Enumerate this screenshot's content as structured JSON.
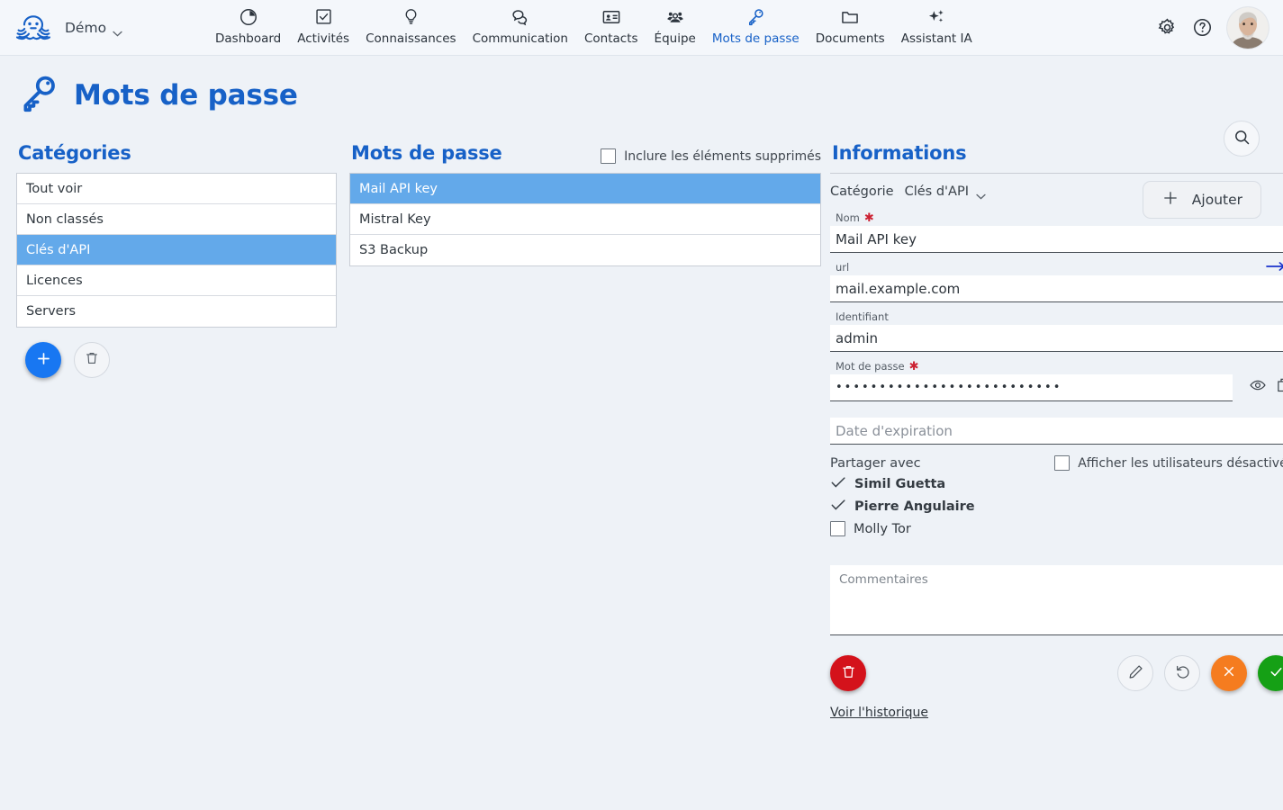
{
  "topbar": {
    "logo_icon": "octopus-logo",
    "org_name": "Démo",
    "org_caret_icon": "chevron-down-icon",
    "nav": [
      {
        "label": "Dashboard",
        "icon": "pie-chart-icon",
        "active": false
      },
      {
        "label": "Activités",
        "icon": "checkbox-icon",
        "active": false
      },
      {
        "label": "Connaissances",
        "icon": "lightbulb-icon",
        "active": false
      },
      {
        "label": "Communication",
        "icon": "chat-bubbles-icon",
        "active": false
      },
      {
        "label": "Contacts",
        "icon": "contact-card-icon",
        "active": false
      },
      {
        "label": "Équipe",
        "icon": "people-icon",
        "active": false
      },
      {
        "label": "Mots de passe",
        "icon": "key-icon",
        "active": true
      },
      {
        "label": "Documents",
        "icon": "folder-icon",
        "active": false
      },
      {
        "label": "Assistant IA",
        "icon": "sparkles-icon",
        "active": false
      }
    ],
    "settings_icon": "gear-icon",
    "help_icon": "help-circle-icon",
    "avatar_icon": "user-avatar-photo"
  },
  "page": {
    "title": "Mots de passe",
    "title_icon": "key-icon",
    "search_icon": "search-icon",
    "add_label": "Ajouter",
    "add_icon": "plus-icon"
  },
  "categories": {
    "title": "Catégories",
    "items": [
      {
        "label": "Tout voir",
        "selected": false
      },
      {
        "label": "Non classés",
        "selected": false
      },
      {
        "label": "Clés d'API",
        "selected": true
      },
      {
        "label": "Licences",
        "selected": false
      },
      {
        "label": "Servers",
        "selected": false
      }
    ],
    "add_icon": "plus-icon",
    "delete_icon": "trash-icon"
  },
  "passwords": {
    "title": "Mots de passe",
    "include_deleted_label": "Inclure les éléments supprimés",
    "include_deleted_checked": false,
    "items": [
      {
        "label": "Mail API key",
        "selected": true
      },
      {
        "label": "Mistral Key",
        "selected": false
      },
      {
        "label": "S3 Backup",
        "selected": false
      }
    ]
  },
  "info": {
    "title": "Informations",
    "category_label": "Catégorie",
    "category_value": "Clés d'API",
    "category_caret_icon": "chevron-down-icon",
    "fields": {
      "name_label": "Nom",
      "name_value": "Mail API key",
      "url_label": "url",
      "url_value": "mail.example.com",
      "url_open_icon": "arrow-right-icon",
      "login_label": "Identifiant",
      "login_value": "admin",
      "password_label": "Mot de passe",
      "password_value": "••••••••••••••••••••••••••",
      "password_reveal_icon": "eye-icon",
      "password_copy_icon": "copy-icon",
      "expiry_placeholder": "Date d'expiration",
      "expiry_value": ""
    },
    "share": {
      "label": "Partager avec",
      "show_disabled_label": "Afficher les utilisateurs désactivés",
      "show_disabled_checked": false,
      "users": [
        {
          "name": "Simil Guetta",
          "checked": true
        },
        {
          "name": "Pierre Angulaire",
          "checked": true
        },
        {
          "name": "Molly Tor",
          "checked": false
        }
      ]
    },
    "comments_placeholder": "Commentaires",
    "comments_value": "",
    "actions": {
      "delete_icon": "trash-icon",
      "edit_icon": "pencil-icon",
      "revert_icon": "undo-icon",
      "cancel_icon": "close-x-icon",
      "confirm_icon": "check-icon"
    },
    "history_link": "Voir l'historique"
  },
  "colors": {
    "brand_blue": "#1761c7",
    "selection_blue": "#63a9ea",
    "fab_blue": "#1877f2",
    "danger_red": "#d4121b",
    "warn_orange": "#f57c1f",
    "confirm_green": "#15a015",
    "required_red": "#cc2233",
    "page_bg": "#eef2f7"
  }
}
